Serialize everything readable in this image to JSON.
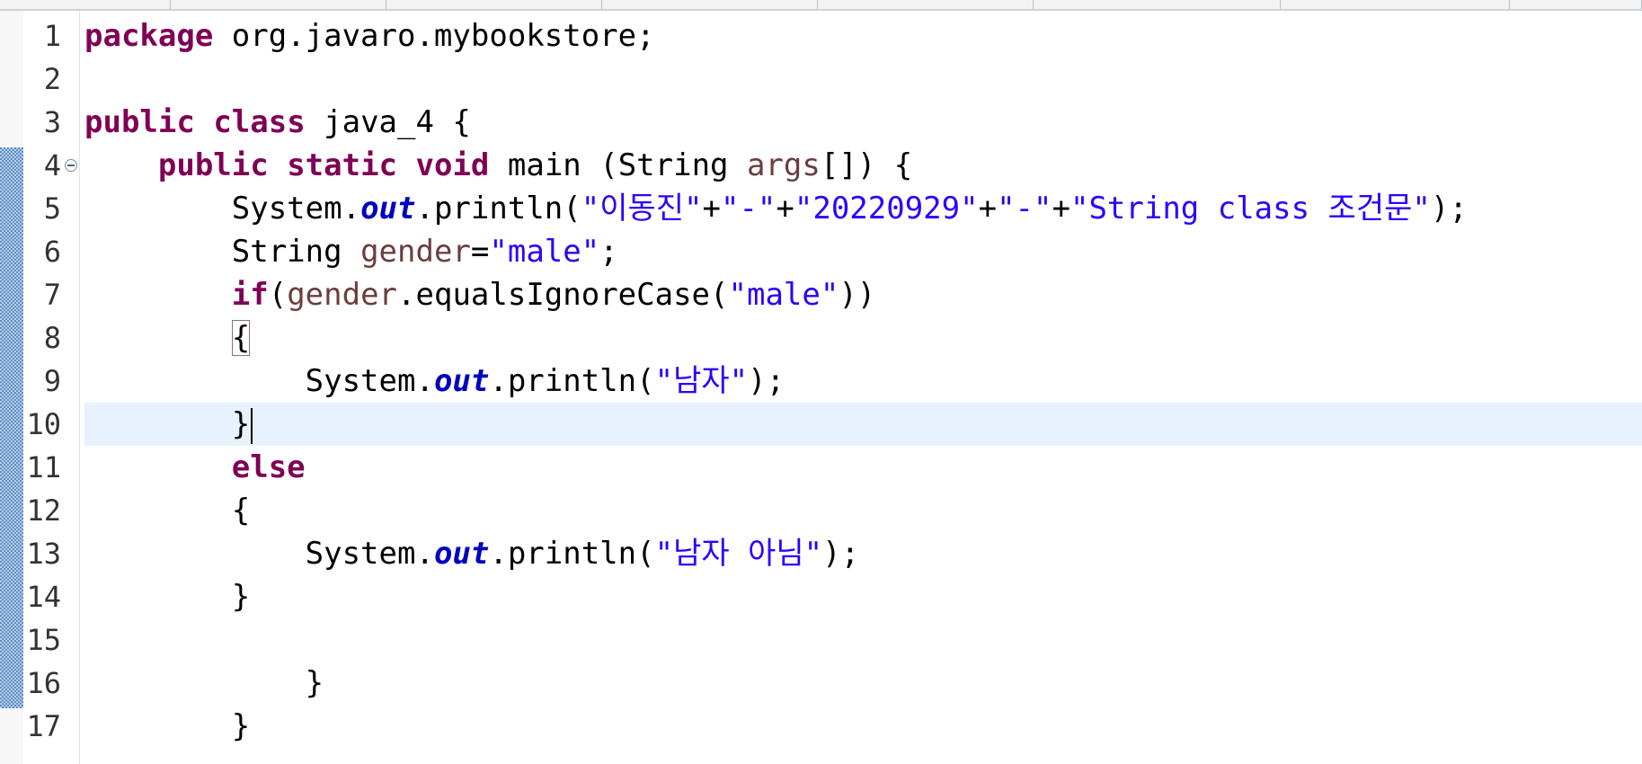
{
  "editor": {
    "language": "java",
    "tabs_visible": 8,
    "current_line": 10,
    "folded_line": 4,
    "bracket_match_line": 8,
    "change_ruler": {
      "from_line": 4,
      "to_line": 16
    },
    "colors": {
      "keyword": "#7f0055",
      "string": "#2a00ff",
      "static_field": "#0000c0",
      "local_variable": "#6a3e3e",
      "current_line_bg": "#e8f2fe",
      "change_ruler": "#5f8fc9"
    },
    "icons": {
      "fold": "collapse-minus-icon"
    },
    "lines": [
      {
        "n": "1",
        "indent": "",
        "tokens": [
          {
            "t": "kw",
            "v": "package"
          },
          {
            "t": "pln",
            "v": " org.javaro.mybookstore;"
          }
        ]
      },
      {
        "n": "2",
        "indent": "",
        "tokens": []
      },
      {
        "n": "3",
        "indent": "",
        "tokens": [
          {
            "t": "kw",
            "v": "public"
          },
          {
            "t": "pln",
            "v": " "
          },
          {
            "t": "kw",
            "v": "class"
          },
          {
            "t": "pln",
            "v": " java_4 {"
          }
        ]
      },
      {
        "n": "4",
        "indent": "    ",
        "tokens": [
          {
            "t": "kw",
            "v": "public"
          },
          {
            "t": "pln",
            "v": " "
          },
          {
            "t": "kw",
            "v": "static"
          },
          {
            "t": "pln",
            "v": " "
          },
          {
            "t": "kw",
            "v": "void"
          },
          {
            "t": "pln",
            "v": " main (String "
          },
          {
            "t": "var",
            "v": "args"
          },
          {
            "t": "pln",
            "v": "[]) {"
          }
        ]
      },
      {
        "n": "5",
        "indent": "        ",
        "tokens": [
          {
            "t": "pln",
            "v": "System."
          },
          {
            "t": "fld",
            "v": "out"
          },
          {
            "t": "pln",
            "v": ".println("
          },
          {
            "t": "str",
            "v": "\"이동진\""
          },
          {
            "t": "pln",
            "v": "+"
          },
          {
            "t": "str",
            "v": "\"-\""
          },
          {
            "t": "pln",
            "v": "+"
          },
          {
            "t": "str",
            "v": "\"20220929\""
          },
          {
            "t": "pln",
            "v": "+"
          },
          {
            "t": "str",
            "v": "\"-\""
          },
          {
            "t": "pln",
            "v": "+"
          },
          {
            "t": "str",
            "v": "\"String class 조건문\""
          },
          {
            "t": "pln",
            "v": ");"
          }
        ]
      },
      {
        "n": "6",
        "indent": "        ",
        "tokens": [
          {
            "t": "pln",
            "v": "String "
          },
          {
            "t": "var",
            "v": "gender"
          },
          {
            "t": "pln",
            "v": "="
          },
          {
            "t": "str",
            "v": "\"male\""
          },
          {
            "t": "pln",
            "v": ";"
          }
        ]
      },
      {
        "n": "7",
        "indent": "        ",
        "tokens": [
          {
            "t": "kw",
            "v": "if"
          },
          {
            "t": "pln",
            "v": "("
          },
          {
            "t": "var",
            "v": "gender"
          },
          {
            "t": "pln",
            "v": ".equalsIgnoreCase("
          },
          {
            "t": "str",
            "v": "\"male\""
          },
          {
            "t": "pln",
            "v": "))"
          }
        ]
      },
      {
        "n": "8",
        "indent": "        ",
        "tokens": [
          {
            "t": "box",
            "v": "{"
          }
        ]
      },
      {
        "n": "9",
        "indent": "            ",
        "tokens": [
          {
            "t": "pln",
            "v": "System."
          },
          {
            "t": "fld",
            "v": "out"
          },
          {
            "t": "pln",
            "v": ".println("
          },
          {
            "t": "str",
            "v": "\"남자\""
          },
          {
            "t": "pln",
            "v": ");"
          }
        ]
      },
      {
        "n": "10",
        "indent": "        ",
        "tokens": [
          {
            "t": "pln",
            "v": "}"
          },
          {
            "t": "caret",
            "v": ""
          }
        ]
      },
      {
        "n": "11",
        "indent": "        ",
        "tokens": [
          {
            "t": "kw",
            "v": "else"
          }
        ]
      },
      {
        "n": "12",
        "indent": "        ",
        "tokens": [
          {
            "t": "pln",
            "v": "{"
          }
        ]
      },
      {
        "n": "13",
        "indent": "            ",
        "tokens": [
          {
            "t": "pln",
            "v": "System."
          },
          {
            "t": "fld",
            "v": "out"
          },
          {
            "t": "pln",
            "v": ".println("
          },
          {
            "t": "str",
            "v": "\"남자 아님\""
          },
          {
            "t": "pln",
            "v": ");"
          }
        ]
      },
      {
        "n": "14",
        "indent": "        ",
        "tokens": [
          {
            "t": "pln",
            "v": "}"
          }
        ]
      },
      {
        "n": "15",
        "indent": "",
        "tokens": []
      },
      {
        "n": "16",
        "indent": "            ",
        "tokens": [
          {
            "t": "pln",
            "v": "}"
          }
        ]
      },
      {
        "n": "17",
        "indent": "        ",
        "tokens": [
          {
            "t": "pln",
            "v": "}"
          }
        ]
      }
    ]
  }
}
